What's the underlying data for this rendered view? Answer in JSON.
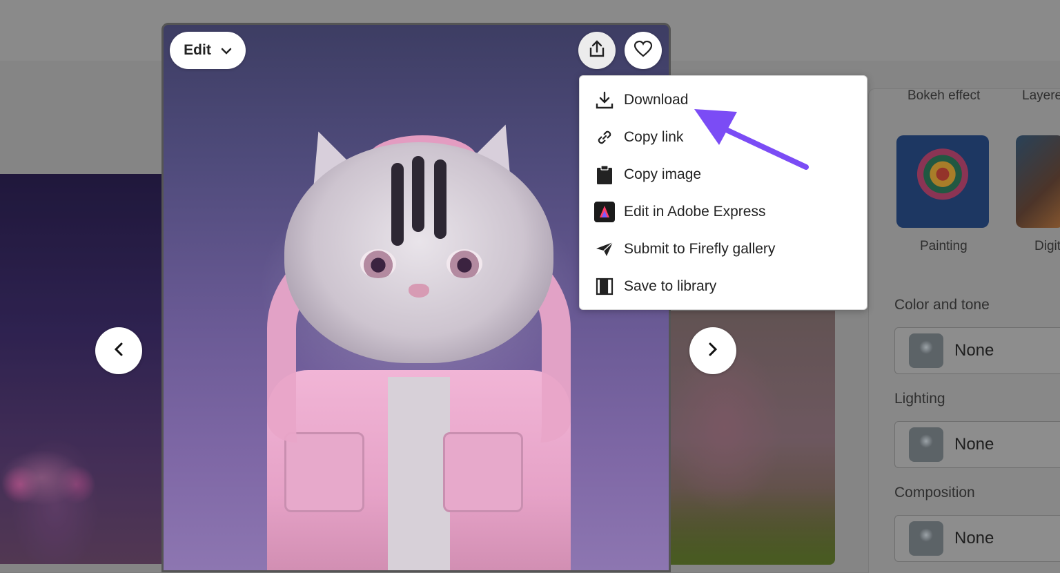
{
  "image_toolbar": {
    "edit_label": "Edit"
  },
  "share_menu": {
    "items": [
      {
        "label": "Download",
        "icon": "download-icon"
      },
      {
        "label": "Copy link",
        "icon": "link-icon"
      },
      {
        "label": "Copy image",
        "icon": "clipboard-icon"
      },
      {
        "label": "Edit in Adobe Express",
        "icon": "adobe-express-icon"
      },
      {
        "label": "Submit to Firefly gallery",
        "icon": "send-icon"
      },
      {
        "label": "Save to library",
        "icon": "library-icon"
      }
    ]
  },
  "right_panel": {
    "style_tabs": [
      "Bokeh effect",
      "Layere"
    ],
    "styles": [
      {
        "label": "Painting"
      },
      {
        "label": "Digit"
      }
    ],
    "sections": [
      {
        "title": "Color and tone",
        "value": "None"
      },
      {
        "title": "Lighting",
        "value": "None"
      },
      {
        "title": "Composition",
        "value": "None"
      }
    ]
  },
  "colors": {
    "annotation_arrow": "#7b4cf5",
    "menu_background": "#ffffff"
  }
}
